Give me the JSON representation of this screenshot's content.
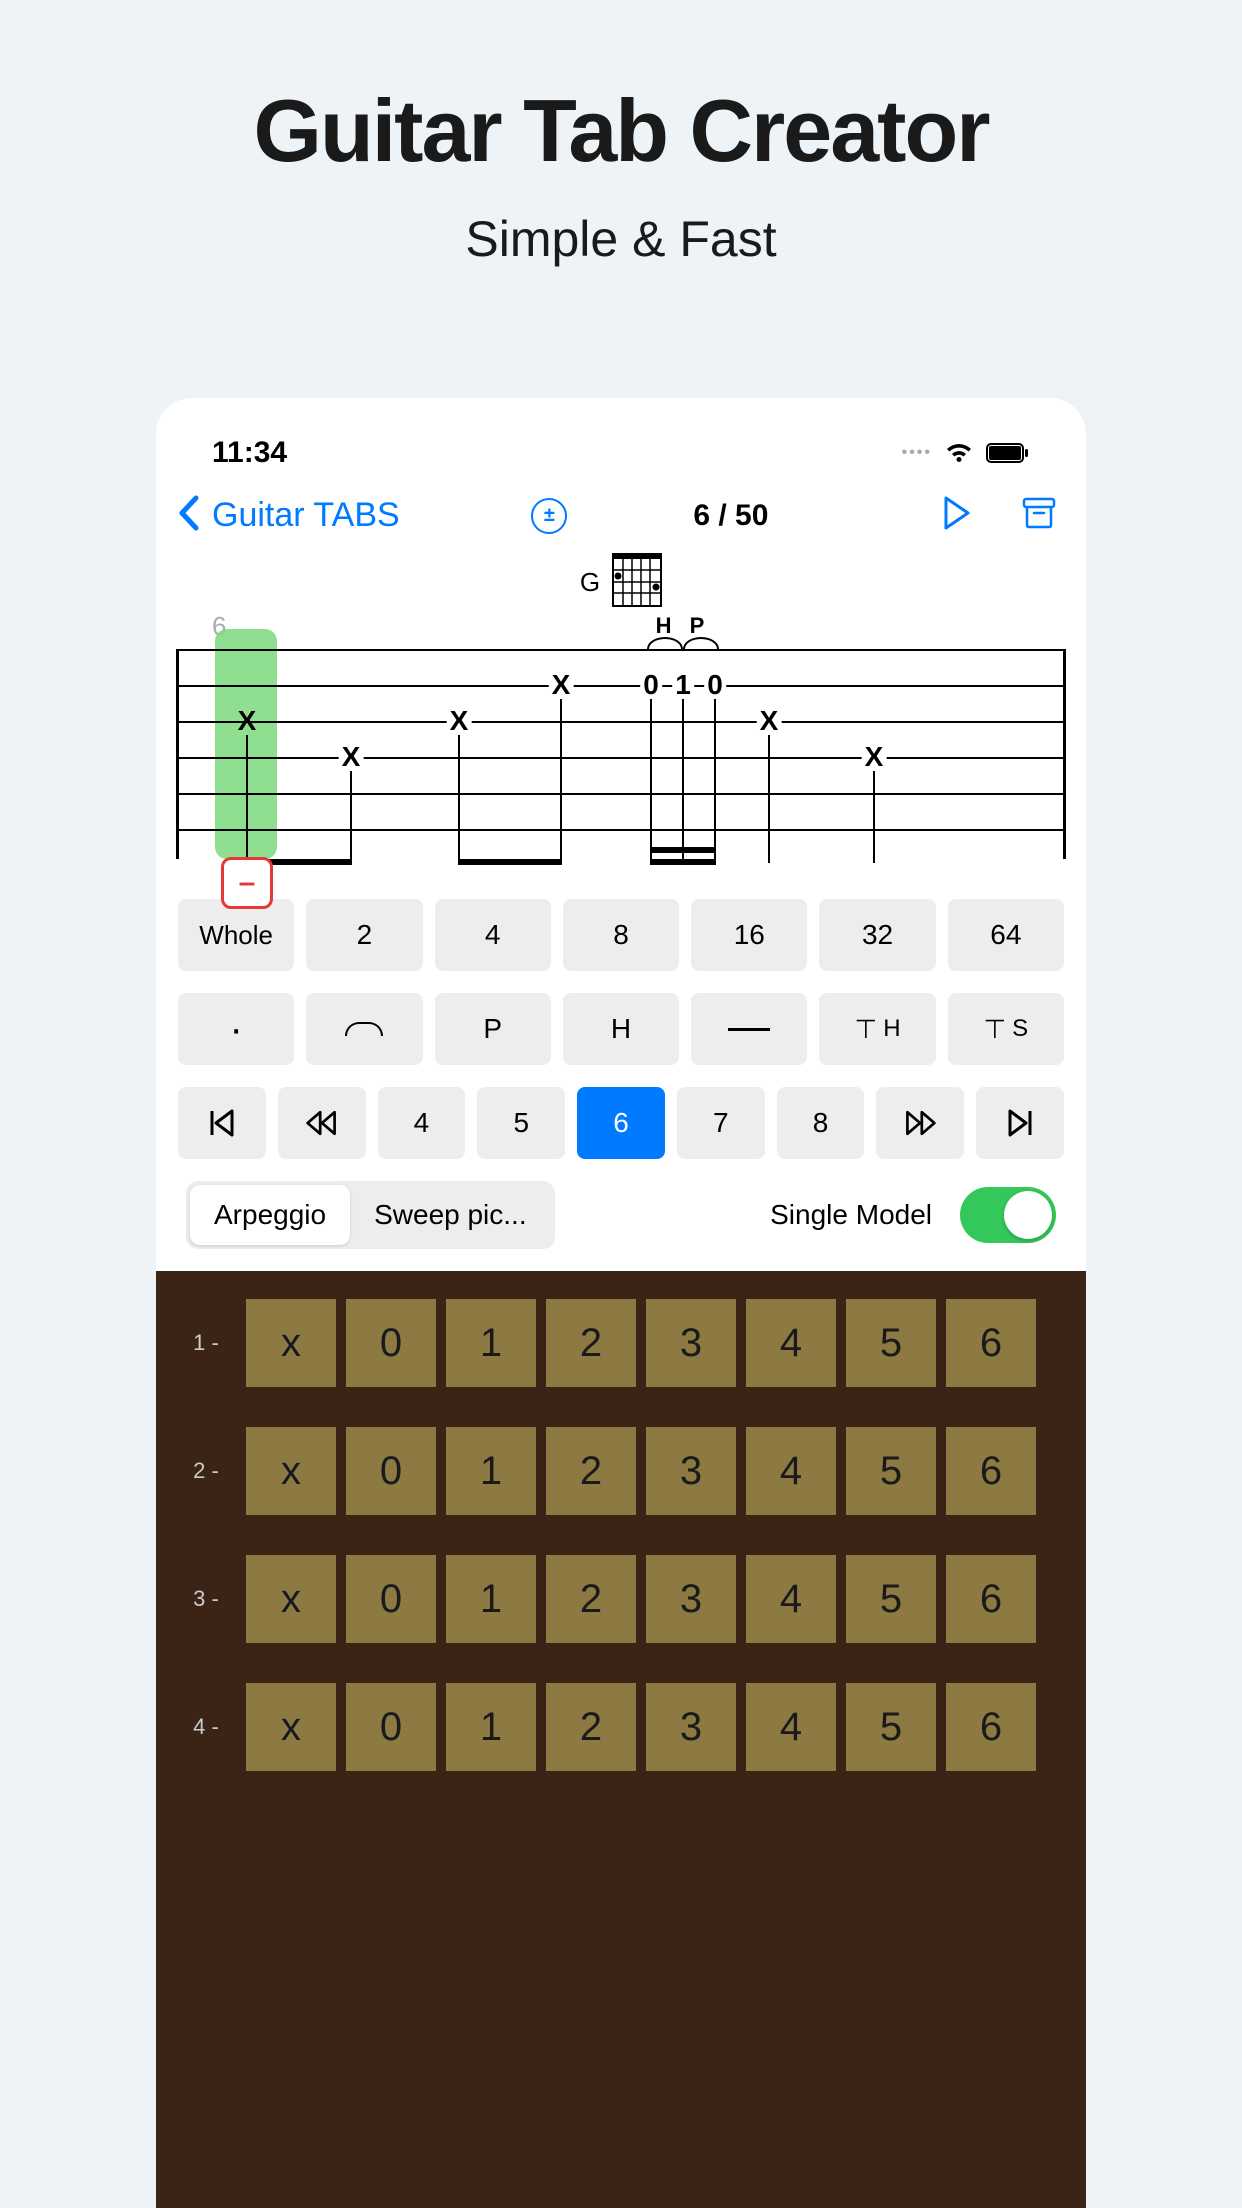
{
  "promo": {
    "title": "Guitar Tab Creator",
    "subtitle": "Simple & Fast"
  },
  "status": {
    "time": "11:34"
  },
  "nav": {
    "back_label": "Guitar TABS",
    "position": "6 / 50"
  },
  "chord": {
    "name": "G"
  },
  "tab": {
    "string_indicator": "6",
    "hp_label": "H P",
    "minus": "–",
    "notes": {
      "col1_s2": "X",
      "col2_s3": "X",
      "col3_s2": "X",
      "col4_s1": "X",
      "col5a_s1": "0",
      "col5b_s1": "1",
      "col5c_s1": "0",
      "col6_s2": "X",
      "col7_s3": "X"
    }
  },
  "durations": [
    "Whole",
    "2",
    "4",
    "8",
    "16",
    "32",
    "64"
  ],
  "ornaments": {
    "dot": "·",
    "p": "P",
    "h": "H",
    "th": "H",
    "ts": "S"
  },
  "positions": [
    "4",
    "5",
    "6",
    "7",
    "8"
  ],
  "active_position_index": 2,
  "mode": {
    "seg1": "Arpeggio",
    "seg2": "Sweep pic...",
    "toggle_label": "Single Model"
  },
  "fretboard": {
    "strings": [
      "1 -",
      "2 -",
      "3 -",
      "4 -"
    ],
    "frets": [
      "x",
      "0",
      "1",
      "2",
      "3",
      "4",
      "5",
      "6"
    ]
  }
}
